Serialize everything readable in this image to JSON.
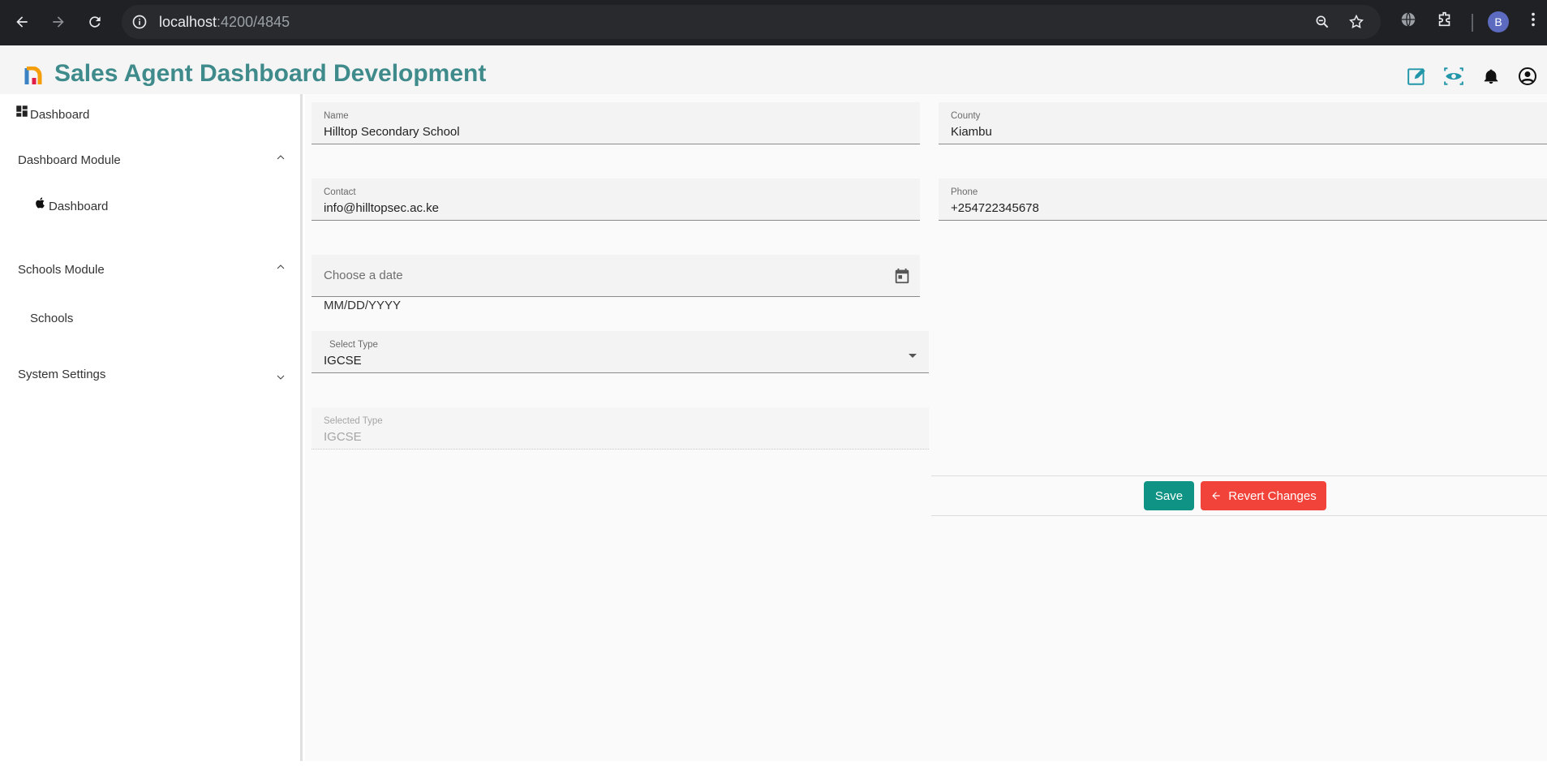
{
  "browser": {
    "url_host": "localhost",
    "url_path": ":4200/4845",
    "profile_initial": "B"
  },
  "header": {
    "title": "Sales Agent Dashboard Development"
  },
  "sidebar": {
    "dashboard_top": "Dashboard",
    "sections": [
      {
        "label": "Dashboard Module",
        "chevron": "up",
        "items": [
          "Dashboard"
        ]
      },
      {
        "label": "Schools Module",
        "chevron": "up",
        "items": [
          "Schools"
        ]
      },
      {
        "label": "System Settings",
        "chevron": "down",
        "items": []
      }
    ]
  },
  "form": {
    "name": {
      "label": "Name",
      "value": "Hilltop Secondary School"
    },
    "county": {
      "label": "County",
      "value": "Kiambu"
    },
    "contact": {
      "label": "Contact",
      "value": "info@hilltopsec.ac.ke"
    },
    "phone": {
      "label": "Phone",
      "value": "+254722345678"
    },
    "date": {
      "placeholder": "Choose a date",
      "hint": "MM/DD/YYYY"
    },
    "select_type": {
      "label": "Select Type",
      "value": "IGCSE"
    },
    "selected_type": {
      "label": "Selected Type",
      "value": "IGCSE"
    }
  },
  "actions": {
    "save_label": "Save",
    "revert_label": "Revert Changes"
  },
  "colors": {
    "title": "#3f8b8c",
    "save": "#0e9384",
    "revert": "#f2433a"
  }
}
